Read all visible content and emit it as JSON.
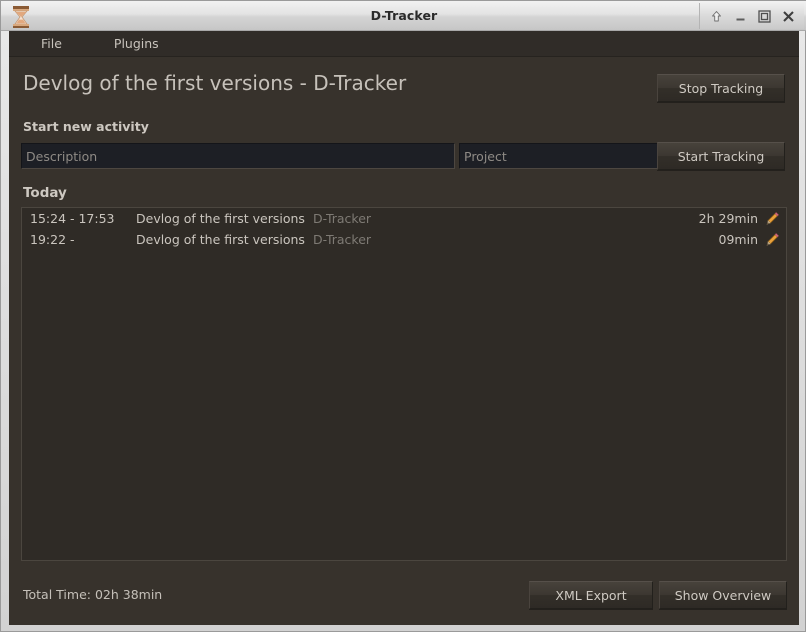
{
  "window": {
    "title": "D-Tracker",
    "icon": "hourglass-icon",
    "controls": {
      "shade": "shade-window",
      "minimize": "minimize-window",
      "maximize": "maximize-window",
      "close": "close-window"
    }
  },
  "menubar": {
    "items": [
      {
        "label": "File"
      },
      {
        "label": "Plugins"
      }
    ]
  },
  "header": {
    "page_title": "Devlog of the first versions - D-Tracker",
    "stop_tracking_label": "Stop Tracking"
  },
  "new_activity": {
    "section_label": "Start new activity",
    "description": {
      "value": "",
      "placeholder": "Description"
    },
    "project": {
      "value": "",
      "placeholder": "Project"
    },
    "start_tracking_label": "Start Tracking"
  },
  "activities": {
    "group_label": "Today",
    "rows": [
      {
        "time": "15:24 - 17:53",
        "description": "Devlog of the first versions",
        "project": "D-Tracker",
        "duration": "2h 29min",
        "edit_icon": "pencil-icon"
      },
      {
        "time": "19:22 -",
        "description": "Devlog of the first versions",
        "project": "D-Tracker",
        "duration": "09min",
        "edit_icon": "pencil-icon"
      }
    ]
  },
  "footer": {
    "total_time": "Total Time: 02h 38min",
    "xml_export_label": "XML Export",
    "show_overview_label": "Show Overview"
  },
  "colors": {
    "window_frame": "#dcdcdc",
    "client_background": "#37322c",
    "menubar_background": "#302c28",
    "list_background": "#2f2b26",
    "text_primary": "#cac5be",
    "text_muted": "#7e7a74",
    "input_background": "#1d1f25",
    "accent_pencil": "#e0902f"
  }
}
